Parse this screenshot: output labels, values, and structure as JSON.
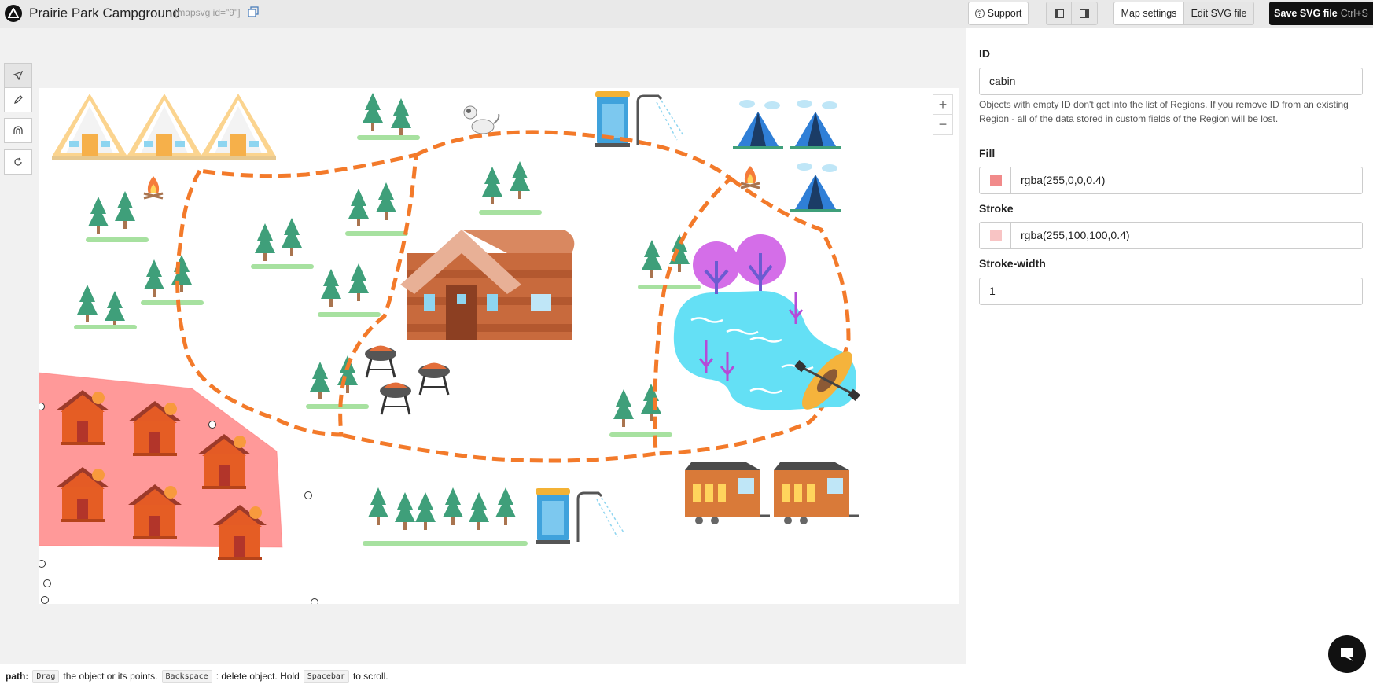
{
  "header": {
    "title": "Prairie Park Campground",
    "shortcode": "[mapsvg id=\"9\"]",
    "support_label": "Support",
    "map_settings_label": "Map settings",
    "edit_svg_label": "Edit SVG file",
    "save_label": "Save SVG file",
    "save_shortcut": "Ctrl+S"
  },
  "panel": {
    "id_label": "ID",
    "id_value": "cabin",
    "id_help": "Objects with empty ID don't get into the list of Regions. If you remove ID from an existing Region - all of the data stored in custom fields of the Region will be lost.",
    "fill_label": "Fill",
    "fill_value": "rgba(255,0,0,0.4)",
    "fill_swatch": "#f18a8a",
    "stroke_label": "Stroke",
    "stroke_value": "rgba(255,100,100,0.4)",
    "stroke_swatch": "#f8c4c4",
    "stroke_width_label": "Stroke-width",
    "stroke_width_value": "1"
  },
  "tools": [
    "select-tool",
    "edit-points-tool",
    "magnet-tool",
    "reset-tool"
  ],
  "zoom": {
    "in_label": "+",
    "out_label": "−"
  },
  "statusbar": {
    "prefix": "path:",
    "key1": "Drag",
    "text1": "the object or its points.",
    "key2": "Backspace",
    "text2": ": delete object. Hold",
    "key3": "Spacebar",
    "text3": "to scroll."
  },
  "colors": {
    "path": "#f37a2a",
    "tree": "#3f9f7a",
    "cabin": "#c86a3d",
    "lake": "#64e0f5",
    "selection": "#ff9a9a"
  }
}
